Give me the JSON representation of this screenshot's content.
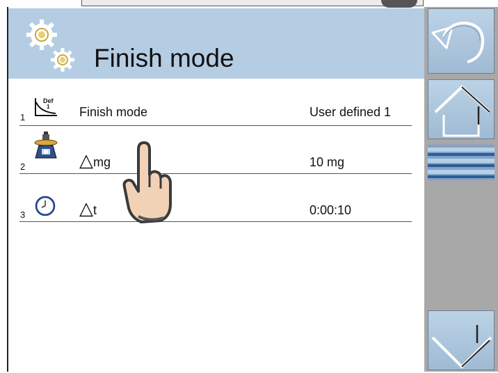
{
  "header": {
    "title": "Finish mode",
    "icon": "gears-icon"
  },
  "rows": [
    {
      "index": "1",
      "icon": "def-curve-icon",
      "label_main": "Finish mode",
      "label_sym": "",
      "label_sub": "",
      "value": "User defined 1"
    },
    {
      "index": "2",
      "icon": "balance-weight-icon",
      "label_main": "",
      "label_sym": "△",
      "label_sub": "mg",
      "value": "10 mg"
    },
    {
      "index": "3",
      "icon": "clock-icon",
      "label_main": "",
      "label_sym": "△",
      "label_sub": "t",
      "value": "0:00:10"
    }
  ],
  "sidebar": {
    "back_icon": "undo-arrow-icon",
    "home_icon": "home-icon",
    "down_icon": "arrow-down-icon",
    "scroll_icon": "scrollbar"
  },
  "colors": {
    "header_bg": "#b5cde2",
    "sidebar_bg": "#a8a8a8",
    "button_bg": "#b0c9df"
  }
}
